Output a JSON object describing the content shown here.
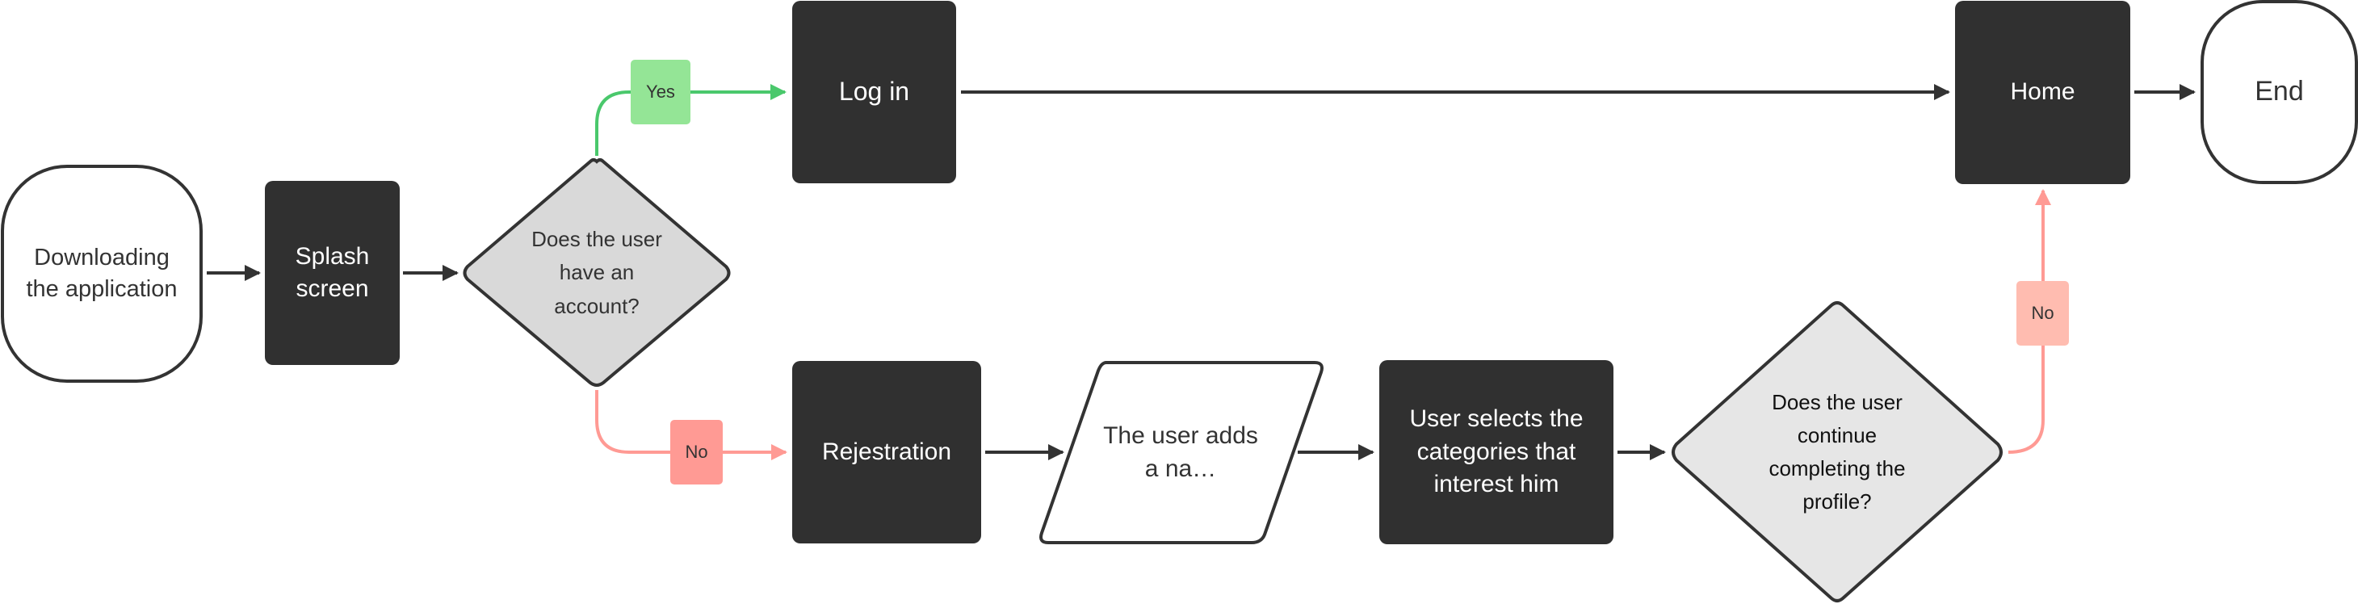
{
  "diagram": {
    "colors": {
      "node_dark": "#303030",
      "stroke": "#333333",
      "decision_1_fill": "#d9d9d9",
      "decision_2_fill": "#e6e6e6",
      "yes_line": "#4ac86c",
      "yes_badge": "#94e596",
      "no_line": "#ff9a94",
      "no_badge_1": "#ff9a94",
      "no_badge_2": "#ffbcb0"
    },
    "nodes": {
      "start": "Downloading the application",
      "splash": "Splash screen",
      "decision_account": "Does the user have an account?",
      "login": "Log in",
      "registration": "Rejestration",
      "add_name": "The user adds a na…",
      "categories": "User selects the categories that interest him",
      "decision_profile": "Does the user continue completing the profile?",
      "home": "Home",
      "end": "End"
    },
    "edge_labels": {
      "yes": "Yes",
      "no_account": "No",
      "no_profile": "No"
    },
    "edges": [
      {
        "from": "start",
        "to": "splash"
      },
      {
        "from": "splash",
        "to": "decision_account"
      },
      {
        "from": "decision_account",
        "to": "login",
        "label": "Yes"
      },
      {
        "from": "decision_account",
        "to": "registration",
        "label": "No"
      },
      {
        "from": "login",
        "to": "home"
      },
      {
        "from": "registration",
        "to": "add_name"
      },
      {
        "from": "add_name",
        "to": "categories"
      },
      {
        "from": "categories",
        "to": "decision_profile"
      },
      {
        "from": "decision_profile",
        "to": "home",
        "label": "No"
      },
      {
        "from": "home",
        "to": "end"
      }
    ]
  }
}
